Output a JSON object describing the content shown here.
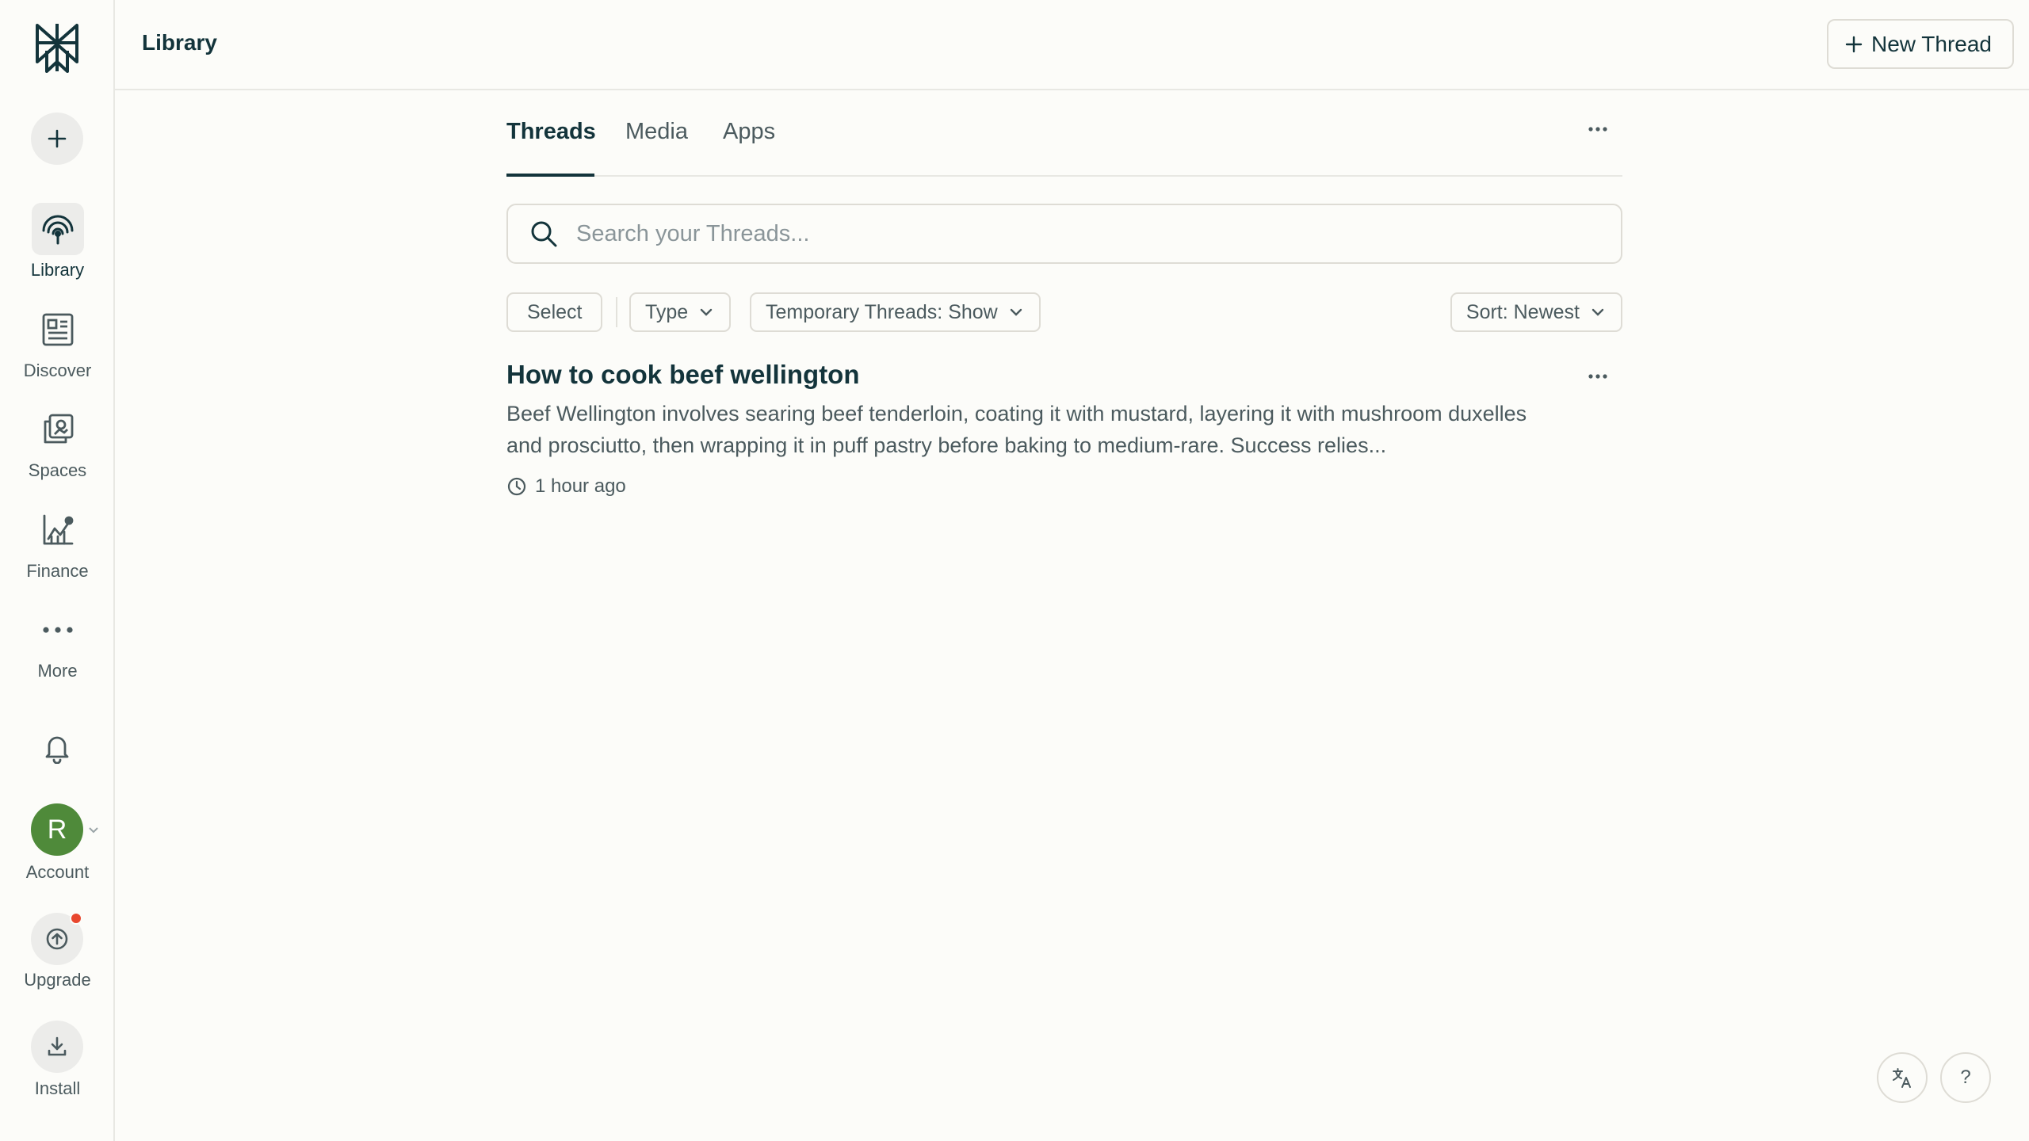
{
  "sidebar": {
    "items": [
      {
        "label": "Library",
        "icon": "library-icon"
      },
      {
        "label": "Discover",
        "icon": "discover-icon"
      },
      {
        "label": "Spaces",
        "icon": "spaces-icon"
      },
      {
        "label": "Finance",
        "icon": "finance-icon"
      },
      {
        "label": "More",
        "icon": "more-dots-icon"
      }
    ],
    "account": {
      "initial": "R",
      "label": "Account"
    },
    "upgrade_label": "Upgrade",
    "install_label": "Install"
  },
  "header": {
    "title": "Library",
    "new_thread_label": "New Thread"
  },
  "tabs": [
    {
      "label": "Threads",
      "active": true
    },
    {
      "label": "Media",
      "active": false
    },
    {
      "label": "Apps",
      "active": false
    }
  ],
  "search": {
    "placeholder": "Search your Threads...",
    "value": ""
  },
  "filters": {
    "select_label": "Select",
    "type_label": "Type",
    "temporary_label": "Temporary Threads: Show",
    "sort_label": "Sort: Newest"
  },
  "threads": [
    {
      "title": "How to cook beef wellington",
      "snippet": "Beef Wellington involves searing beef tenderloin, coating it with mustard, layering it with mushroom duxelles and prosciutto, then wrapping it in puff pastry before baking to medium-rare. Success relies...",
      "time": "1 hour ago"
    }
  ],
  "corner": {
    "help_label": "?"
  },
  "colors": {
    "text": "#13343b",
    "muted": "#4b5a5e",
    "avatar": "#4f8a3a",
    "notification_dot": "#e8472e",
    "background": "#fcfcf9"
  }
}
